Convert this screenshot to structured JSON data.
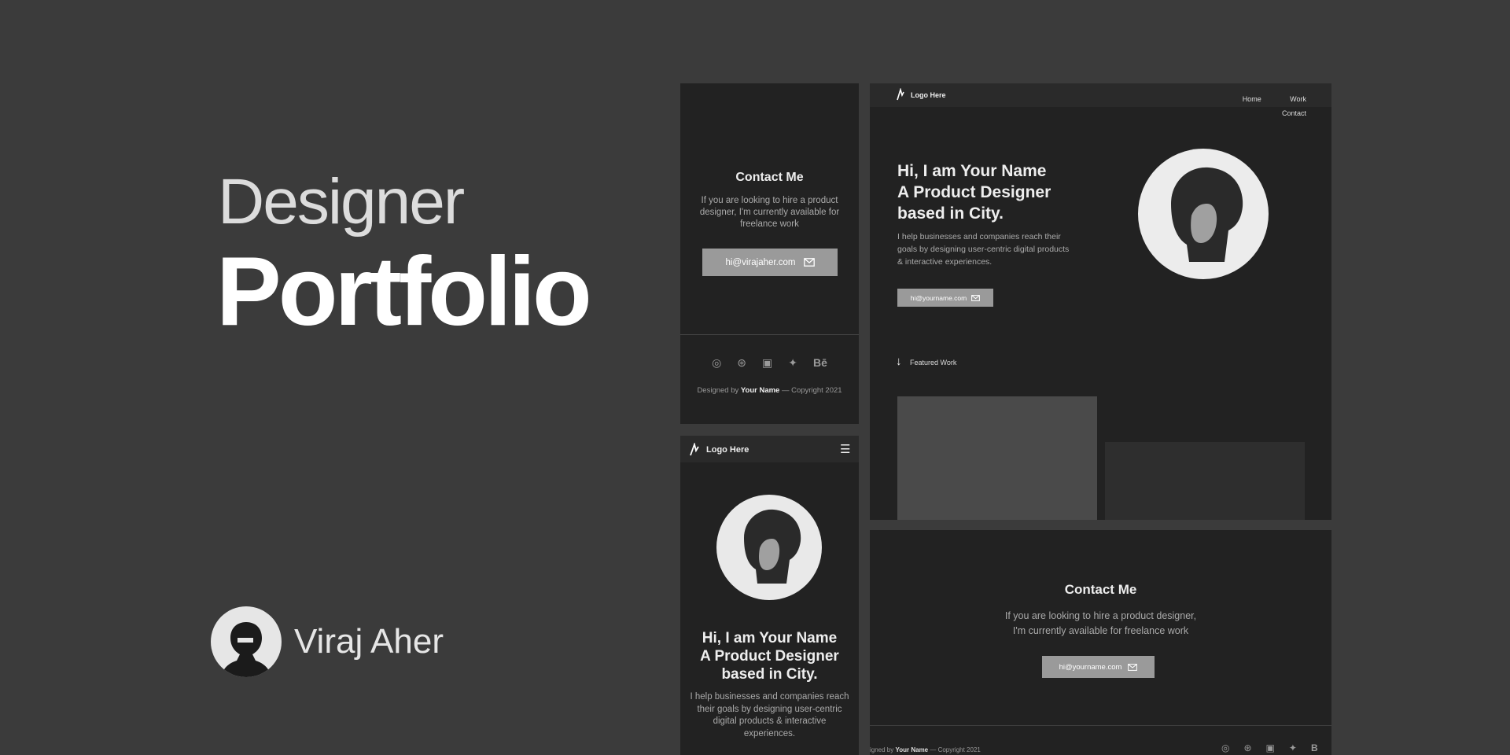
{
  "hero": {
    "title_line1": "Designer",
    "title_line2": "Portfolio",
    "author_name": "Viraj Aher"
  },
  "mobile_contact": {
    "heading": "Contact Me",
    "body": "If you are looking to hire a product designer, I'm currently available for freelance work",
    "email": "hi@virajaher.com",
    "footer_prefix": "Designed by",
    "footer_name": "Your Name",
    "footer_suffix": "— Copyright 2021",
    "social": [
      "whatsapp-icon",
      "dribbble-icon",
      "linkedin-icon",
      "twitter-icon",
      "behance-icon"
    ]
  },
  "mobile_home": {
    "logo_text": "Logo Here",
    "heading_line1": "Hi, I am Your Name",
    "heading_line2": "A Product Designer",
    "heading_line3": "based in City.",
    "body": "I help businesses and companies reach their goals by designing user-centric digital products & interactive experiences."
  },
  "desktop_home": {
    "logo_text": "Logo Here",
    "nav": [
      "Home",
      "Work",
      "Contact"
    ],
    "heading_line1": "Hi, I am Your Name",
    "heading_line2": "A Product Designer",
    "heading_line3": "based in City.",
    "body": "I help businesses and companies reach their goals by designing user-centric digital products & interactive experiences.",
    "email": "hi@yourname.com",
    "featured_label": "Featured Work"
  },
  "desktop_contact": {
    "heading": "Contact Me",
    "body_line1": "If you are looking to hire a product designer,",
    "body_line2": "I'm currently available for freelance work",
    "email": "hi@yourname.com",
    "footer_prefix": "igned by",
    "footer_name": "Your Name",
    "footer_suffix": "— Copyright 2021"
  },
  "colors": {
    "background": "#3b3b3b",
    "panel": "#222222",
    "button": "#9a9a9a"
  }
}
